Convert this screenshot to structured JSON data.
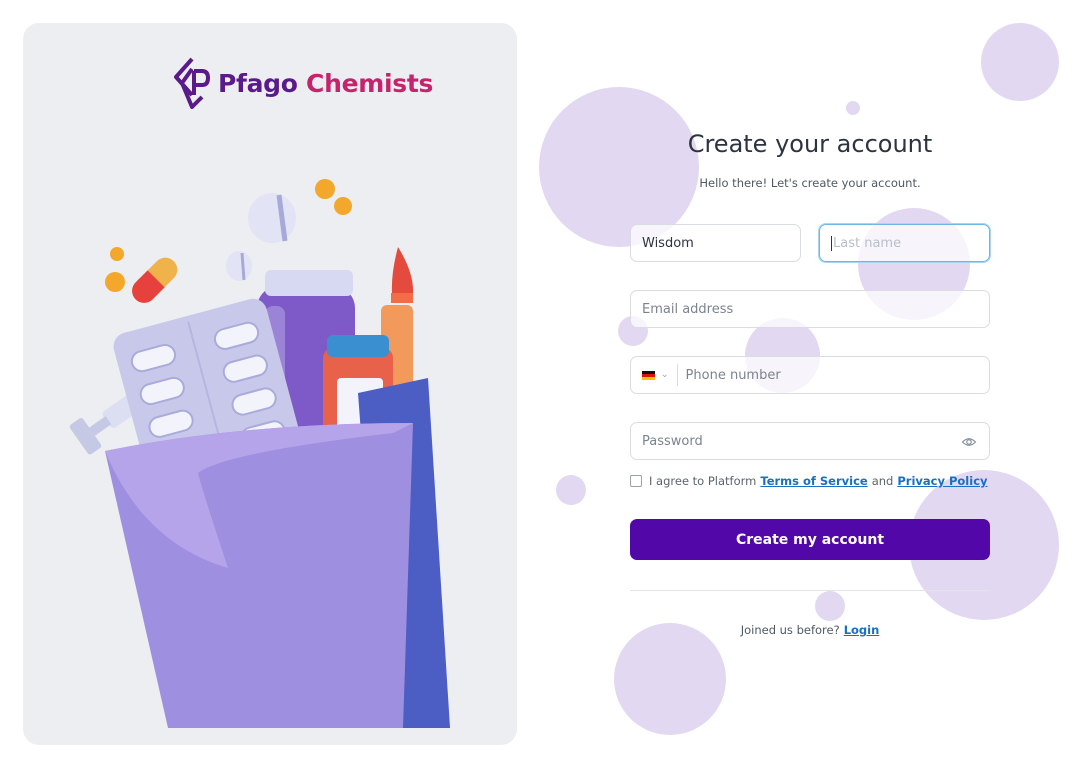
{
  "brand": {
    "name_part1": "Pfago",
    "name_part2": "Chemists",
    "primary_color": "#5a1a8a",
    "secondary_color": "#c4246c"
  },
  "form": {
    "title": "Create your account",
    "subtitle": "Hello there! Let's create your account.",
    "first_name": {
      "value": "Wisdom"
    },
    "last_name": {
      "placeholder": "Last name",
      "value": ""
    },
    "email": {
      "placeholder": "Email address"
    },
    "phone": {
      "placeholder": "Phone number",
      "country_flag_icon": "germany-flag-icon"
    },
    "password": {
      "placeholder": "Password",
      "toggle_icon": "eye-icon"
    },
    "agree": {
      "prefix": "I agree to Platform",
      "terms": "Terms of Service",
      "and": "and",
      "privacy": "Privacy Policy"
    },
    "submit_label": "Create my account",
    "login_prompt": "Joined us before?",
    "login_link": "Login"
  },
  "colors": {
    "button": "#5208a8",
    "link": "#1a6fc0",
    "bubble": "#e3d8f1",
    "panel_bg": "#eceef1"
  }
}
